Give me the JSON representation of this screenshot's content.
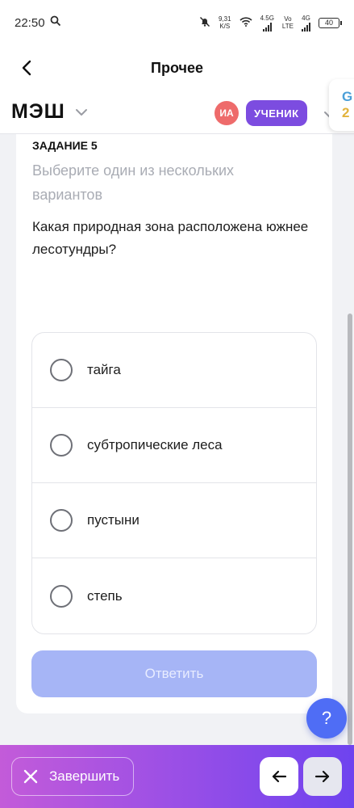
{
  "status_bar": {
    "time": "22:50",
    "net_speed_value": "9,31",
    "net_speed_unit": "K/S",
    "net_type_1": "4.5G",
    "volte_top": "Vo",
    "volte_bottom": "LTE",
    "net_type_2": "4G",
    "battery": "40"
  },
  "app_bar": {
    "title": "Прочее"
  },
  "mesh_header": {
    "logo": "МЭШ",
    "avatar_initials": "ИА",
    "role": "УЧЕНИК",
    "side_widget_line1": "G",
    "side_widget_line2": "2"
  },
  "task": {
    "label": "ЗАДАНИЕ 5",
    "hint": "Выберите один из нескольких вариантов",
    "question": "Какая природная зона расположена южнее лесотундры?",
    "options": [
      {
        "label": "тайга"
      },
      {
        "label": "субтропические леса"
      },
      {
        "label": "пустыни"
      },
      {
        "label": "степь"
      }
    ],
    "submit_label": "Ответить"
  },
  "help": {
    "label": "?"
  },
  "bottom_bar": {
    "finish_label": "Завершить"
  },
  "colors": {
    "accent_purple": "#7c4ce0",
    "submit_disabled": "#a6b5f6",
    "help_blue": "#4f6df5",
    "avatar_red": "#ee6b6b"
  }
}
